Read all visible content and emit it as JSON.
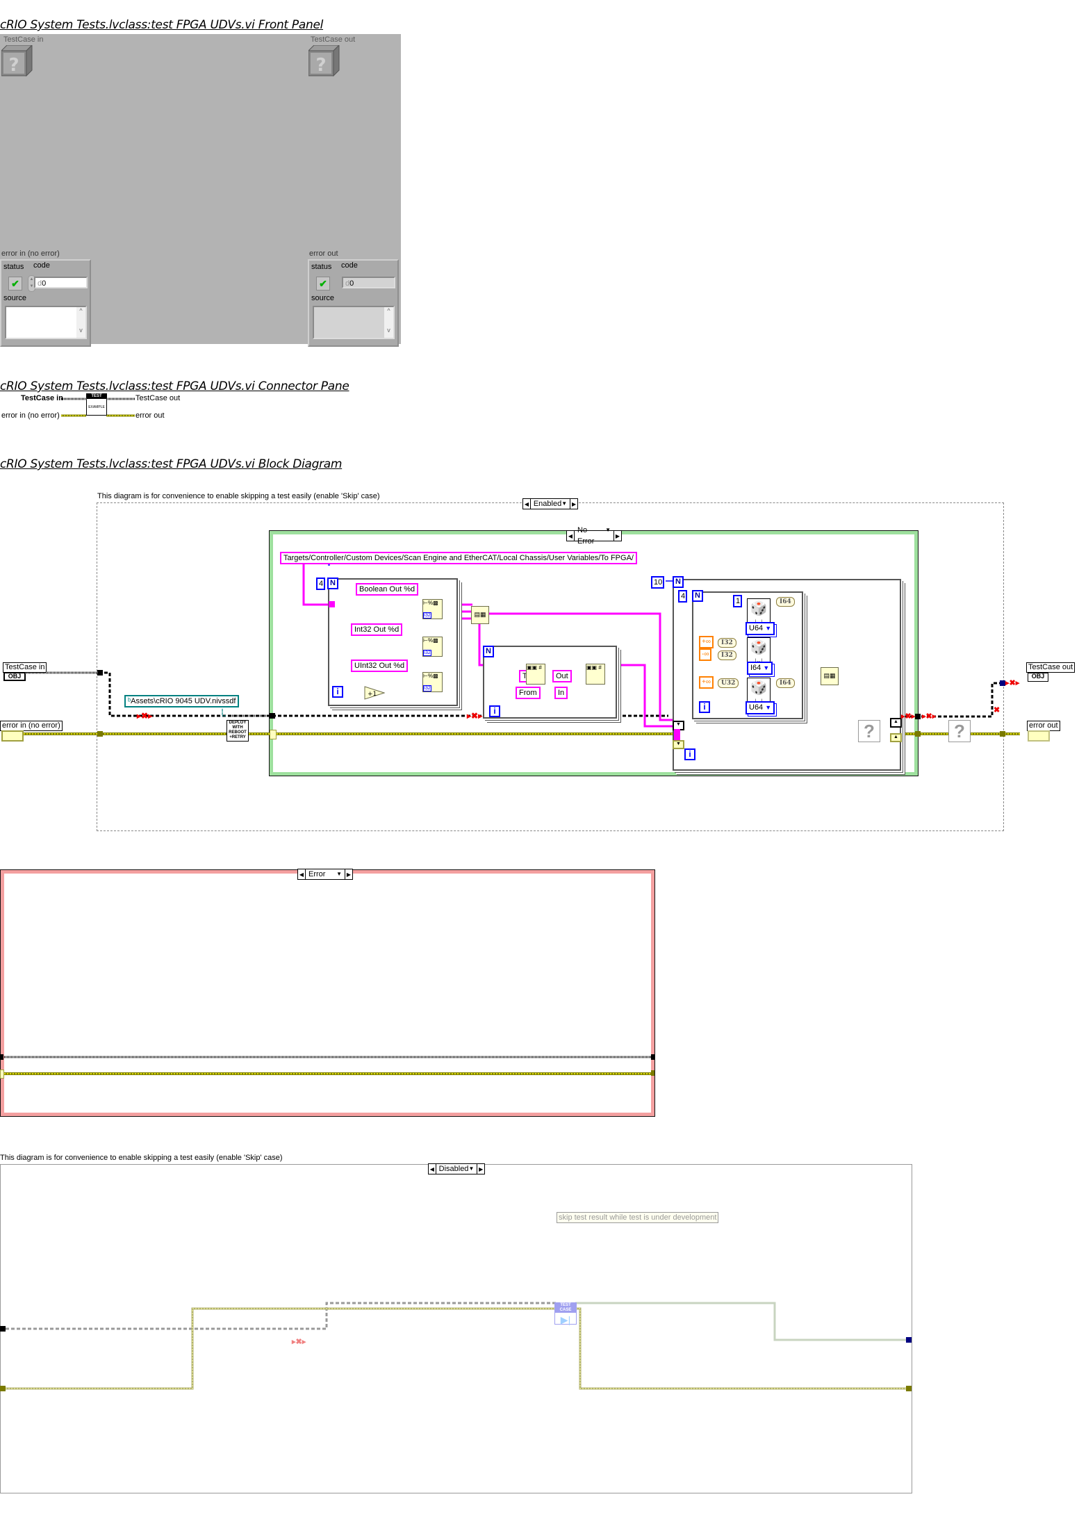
{
  "front_panel": {
    "title": "cRIO System Tests.lvclass:test FPGA UDVs.vi Front Panel",
    "testcase_in_label": "TestCase in",
    "testcase_out_label": "TestCase out",
    "error_in": {
      "label": "error in (no error)",
      "status_label": "status",
      "code_label": "code",
      "code_value": "0",
      "code_radix": "d",
      "source_label": "source",
      "source_value": "",
      "status_icon": "checkmark-icon"
    },
    "error_out": {
      "label": "error out",
      "status_label": "status",
      "code_label": "code",
      "code_value": "0",
      "code_radix": "d",
      "source_label": "source",
      "source_value": "",
      "status_icon": "checkmark-icon"
    }
  },
  "connector_pane": {
    "title": "cRIO System Tests.lvclass:test FPGA UDVs.vi Connector Pane",
    "inputs": [
      "TestCase in",
      "error in (no error)"
    ],
    "outputs": [
      "TestCase out",
      "error out"
    ],
    "icon_banner": "TEST",
    "icon_text": "EXAMPLE"
  },
  "block_diagram": {
    "title": "cRIO System Tests.lvclass:test FPGA UDVs.vi Block Diagram",
    "enabled_case": {
      "comment": "This diagram is for convenience to enable skipping a test easily (enable 'Skip' case)",
      "selector": "Enabled",
      "testcase_in": "TestCase in",
      "error_in": "error in (no error)",
      "testcase_out": "TestCase out",
      "error_out": "error out",
      "asset_path": "Assets\\cRIO 9045 UDV.nivssdf",
      "deploy_node": [
        "DEPLOY",
        "WITH",
        "REBOOT",
        "+RETRY"
      ],
      "inner_case_selector": "No Error",
      "base_path": "Targets/Controller/Custom Devices/Scan Engine and EtherCAT/Local Chassis/User Variables/To FPGA/",
      "loop1": {
        "count": "4",
        "formats": [
          "Boolean Out %d",
          "Int32 Out %d",
          "UInt32 Out %d"
        ],
        "increment_label": "+1",
        "type_tag": "I32"
      },
      "loop2": {
        "strings": [
          "To",
          "From",
          "Out",
          "In"
        ]
      },
      "outer_loop_count": "10",
      "inner_loop_count": "4",
      "random_rows": [
        {
          "inputs": [
            "1"
          ],
          "cast": "I64",
          "type": "U64"
        },
        {
          "inputs": [
            "+∞",
            "-∞"
          ],
          "input_casts": [
            "I32",
            "I32"
          ],
          "type": "I64"
        },
        {
          "inputs": [
            "+∞"
          ],
          "input_casts": [
            "U32"
          ],
          "cast": "I64",
          "type": "U64"
        }
      ],
      "terminal_types": {
        "obj": "OBJ",
        "n": "N",
        "i": "i"
      }
    },
    "error_case": {
      "selector": "Error"
    },
    "disabled_case": {
      "comment": "This diagram is for convenience to enable skipping a test easily (enable 'Skip' case)",
      "selector": "Disabled",
      "note": "skip test result while test is under development",
      "skip_node_label": "TEST CASE"
    }
  }
}
